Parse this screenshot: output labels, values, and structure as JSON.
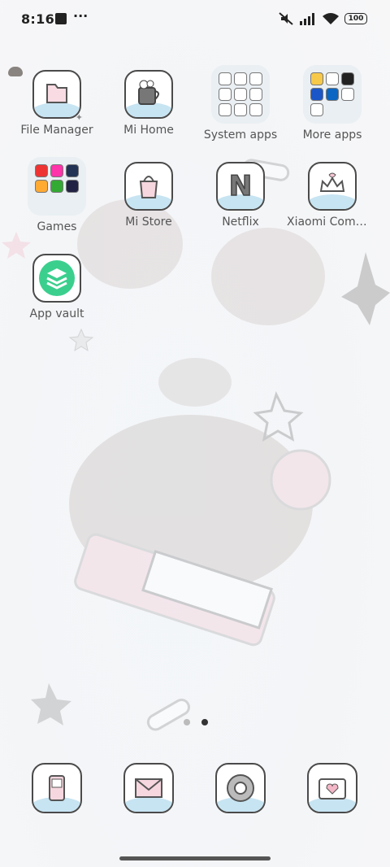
{
  "status_bar": {
    "time": "8:16",
    "battery": "100"
  },
  "home": {
    "apps": [
      {
        "label": "File Manager",
        "kind": "app"
      },
      {
        "label": "Mi Home",
        "kind": "app"
      },
      {
        "label": "System apps",
        "kind": "folder"
      },
      {
        "label": "More apps",
        "kind": "folder"
      },
      {
        "label": "Games",
        "kind": "folder"
      },
      {
        "label": "Mi Store",
        "kind": "app"
      },
      {
        "label": "Netflix",
        "kind": "app"
      },
      {
        "label": "Xiaomi Comm…",
        "kind": "app"
      },
      {
        "label": "App vault",
        "kind": "app"
      }
    ],
    "netflix_letter": "N"
  },
  "page_indicator": {
    "pages": 2,
    "current": 2
  },
  "dock": {
    "apps": [
      {
        "name": "phone",
        "icon": "phone-icon"
      },
      {
        "name": "messages",
        "icon": "envelope-icon"
      },
      {
        "name": "browser",
        "icon": "chrome-icon"
      },
      {
        "name": "gallery",
        "icon": "camera-heart-icon"
      }
    ]
  }
}
